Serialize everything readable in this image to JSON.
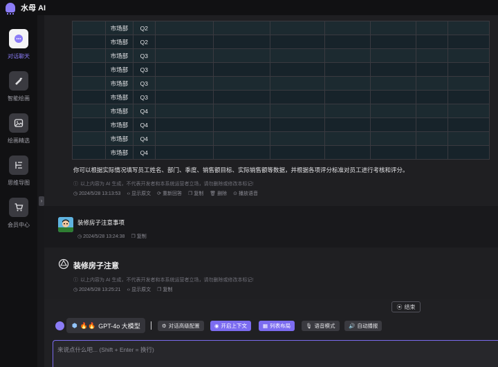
{
  "app": {
    "title": "水母 AI"
  },
  "sidebar": {
    "items": [
      {
        "label": "对话聊天",
        "icon": "chat-icon",
        "active": true
      },
      {
        "label": "智能绘画",
        "icon": "brush-icon",
        "active": false
      },
      {
        "label": "绘画精选",
        "icon": "gallery-icon",
        "active": false
      },
      {
        "label": "思维导图",
        "icon": "mindmap-icon",
        "active": false
      },
      {
        "label": "会员中心",
        "icon": "cart-icon",
        "active": false
      }
    ]
  },
  "table": {
    "rows": [
      [
        "",
        "市场部",
        "Q2",
        "",
        "",
        "",
        "",
        "",
        "",
        ""
      ],
      [
        "",
        "市场部",
        "Q2",
        "",
        "",
        "",
        "",
        "",
        "",
        ""
      ],
      [
        "",
        "市场部",
        "Q3",
        "",
        "",
        "",
        "",
        "",
        "",
        ""
      ],
      [
        "",
        "市场部",
        "Q3",
        "",
        "",
        "",
        "",
        "",
        "",
        ""
      ],
      [
        "",
        "市场部",
        "Q3",
        "",
        "",
        "",
        "",
        "",
        "",
        ""
      ],
      [
        "",
        "市场部",
        "Q3",
        "",
        "",
        "",
        "",
        "",
        "",
        ""
      ],
      [
        "",
        "市场部",
        "Q4",
        "",
        "",
        "",
        "",
        "",
        "",
        ""
      ],
      [
        "",
        "市场部",
        "Q4",
        "",
        "",
        "",
        "",
        "",
        "",
        ""
      ],
      [
        "",
        "市场部",
        "Q4",
        "",
        "",
        "",
        "",
        "",
        "",
        ""
      ],
      [
        "",
        "市场部",
        "Q4",
        "",
        "",
        "",
        "",
        "",
        "",
        ""
      ]
    ]
  },
  "messages": {
    "ai_first": {
      "text": "你可以根据实际情况填写员工姓名、部门、季度、销售额目标、实际销售额等数据，并根据各项评分标准对员工进行考核和评分。",
      "disclaimer": "以上内容为 AI 生成，不代表开发者和本系统运营者立场，请勿删除或修改本标记!",
      "timestamp": "2024/5/28 13:13:53",
      "actions": [
        "显示原文",
        "重新回答",
        "复制",
        "删除",
        "播放语音"
      ]
    },
    "user": {
      "title": "装修房子注意事项",
      "timestamp": "2024/5/28 13:24:38",
      "copy_label": "复制"
    },
    "ai_second": {
      "title": "装修房子注意",
      "disclaimer": "以上内容为 AI 生成，不代表开发者和本系统运营者立场，请勿删除或修改本标记!",
      "timestamp": "2024/5/28 13:25:21",
      "actions": [
        "显示原文",
        "复制"
      ]
    }
  },
  "end_button": "结束",
  "toolbar": {
    "model": "GPT-4o 大模型",
    "chips": [
      {
        "label": "对话高级配置",
        "style": "dark",
        "icon": "settings-icon"
      },
      {
        "label": "开启上下文",
        "style": "purple",
        "icon": "context-icon"
      },
      {
        "label": "列表布局",
        "style": "purple",
        "icon": "list-icon"
      },
      {
        "label": "语音模式",
        "style": "dark",
        "icon": "mic-icon"
      },
      {
        "label": "自动播报",
        "style": "dark",
        "icon": "speaker-icon"
      }
    ]
  },
  "input": {
    "placeholder": "来说点什么吧... (Shift + Enter = 换行)"
  },
  "colors": {
    "accent": "#8b7cf6",
    "chip_purple": "#7c6cf0",
    "background": "#18181b"
  }
}
